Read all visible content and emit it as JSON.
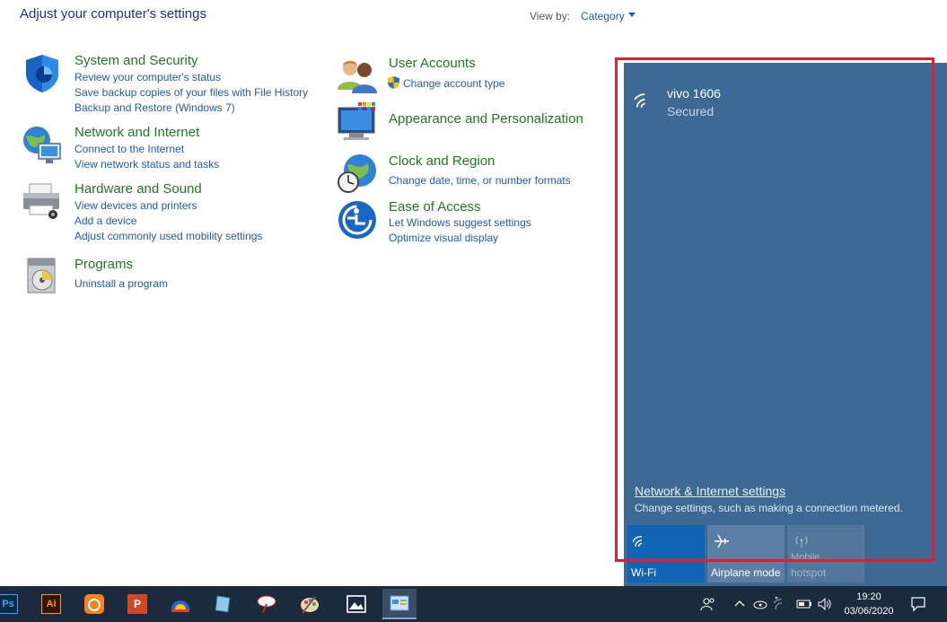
{
  "header": {
    "title": "Adjust your computer's settings",
    "view_by_label": "View by:",
    "view_by_value": "Category"
  },
  "categories": {
    "system": {
      "title": "System and Security",
      "links": [
        "Review your computer's status",
        "Save backup copies of your files with File History",
        "Backup and Restore (Windows 7)"
      ]
    },
    "network": {
      "title": "Network and Internet",
      "links": [
        "Connect to the Internet",
        "View network status and tasks"
      ]
    },
    "hardware": {
      "title": "Hardware and Sound",
      "links": [
        "View devices and printers",
        "Add a device",
        "Adjust commonly used mobility settings"
      ]
    },
    "programs": {
      "title": "Programs",
      "links": [
        "Uninstall a program"
      ]
    },
    "users": {
      "title": "User Accounts",
      "links": [
        "Change account type"
      ]
    },
    "appearance": {
      "title": "Appearance and Personalization",
      "links": []
    },
    "clock": {
      "title": "Clock and Region",
      "links": [
        "Change date, time, or number formats"
      ]
    },
    "ease": {
      "title": "Ease of Access",
      "links": [
        "Let Windows suggest settings",
        "Optimize visual display"
      ]
    }
  },
  "flyout": {
    "ssid": "vivo 1606",
    "status": "Secured",
    "settings_link": "Network & Internet settings",
    "settings_desc": "Change settings, such as making a connection metered.",
    "tiles": [
      {
        "label": "Wi-Fi",
        "icon": "wifi-icon",
        "active": true
      },
      {
        "label": "Airplane mode",
        "icon": "airplane-icon",
        "active": false
      },
      {
        "label": "hotspot",
        "overflow_label": "Mobile",
        "icon": "mobile-hotspot-icon",
        "active": false
      }
    ],
    "colors": {
      "panel": "#3d6a95",
      "active_tile": "#1264b4",
      "highlight_box": "#e01e2e"
    }
  },
  "taskbar": {
    "apps": [
      {
        "name": "photoshop-icon",
        "label": "Ps"
      },
      {
        "name": "illustrator-icon",
        "label": "Ai"
      },
      {
        "name": "uc-browser-icon",
        "label": ""
      },
      {
        "name": "powerpoint-icon",
        "label": "P"
      },
      {
        "name": "vpn-app-icon",
        "label": ""
      },
      {
        "name": "notes-app-icon",
        "label": ""
      },
      {
        "name": "paint-app-icon",
        "label": ""
      },
      {
        "name": "palette-app-icon",
        "label": ""
      },
      {
        "name": "photos-app-icon",
        "label": ""
      },
      {
        "name": "control-panel-icon",
        "label": ""
      }
    ],
    "time": "19:20",
    "date": "03/06/2020"
  }
}
